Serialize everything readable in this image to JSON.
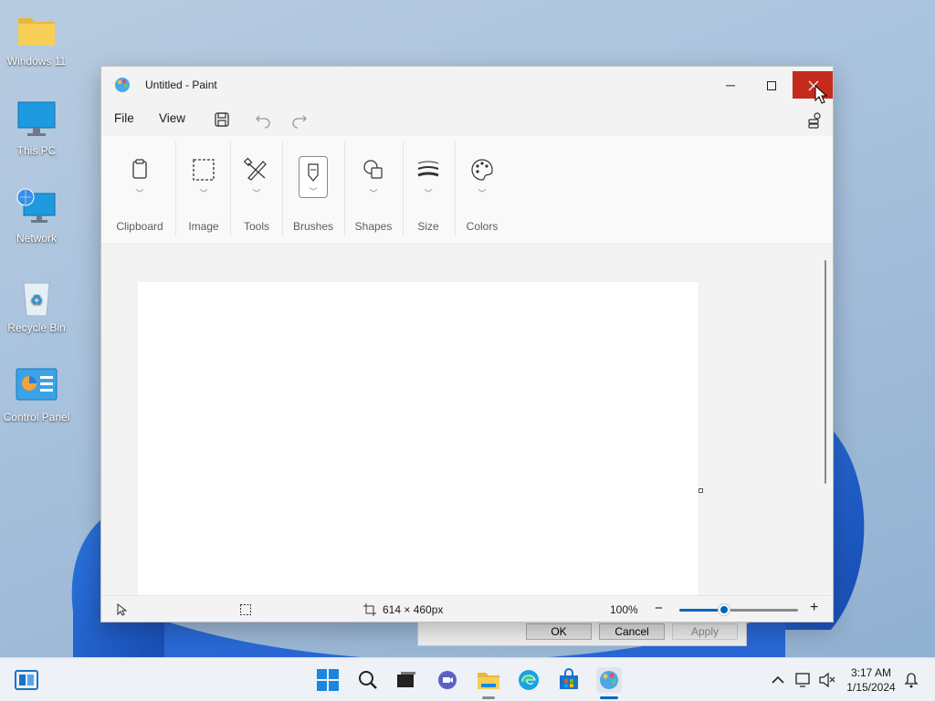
{
  "desktop": {
    "icons": [
      {
        "label": "Windows 11",
        "icon": "folder-icon"
      },
      {
        "label": "This PC",
        "icon": "monitor-icon"
      },
      {
        "label": "Network",
        "icon": "network-icon"
      },
      {
        "label": "Recycle Bin",
        "icon": "recycle-bin-icon"
      },
      {
        "label": "Control Panel",
        "icon": "control-panel-icon"
      }
    ]
  },
  "background_dialog": {
    "ok_label": "OK",
    "cancel_label": "Cancel",
    "apply_label": "Apply"
  },
  "paint": {
    "title": "Untitled - Paint",
    "menu": {
      "file": "File",
      "view": "View"
    },
    "ribbon": {
      "groups": [
        {
          "label": "Clipboard",
          "icon": "clipboard-icon"
        },
        {
          "label": "Image",
          "icon": "selection-icon"
        },
        {
          "label": "Tools",
          "icon": "pencil-eraser-icon"
        },
        {
          "label": "Brushes",
          "icon": "brush-icon"
        },
        {
          "label": "Shapes",
          "icon": "shapes-icon"
        },
        {
          "label": "Size",
          "icon": "line-size-icon"
        },
        {
          "label": "Colors",
          "icon": "palette-icon"
        }
      ]
    },
    "status": {
      "canvas_size": "614 × 460px",
      "zoom": "100%",
      "zoom_fraction": 0.38
    }
  },
  "taskbar": {
    "time": "3:17 AM",
    "date": "1/15/2024"
  },
  "colors": {
    "accent": "#0067c0",
    "close_hover": "#c42b1c"
  }
}
